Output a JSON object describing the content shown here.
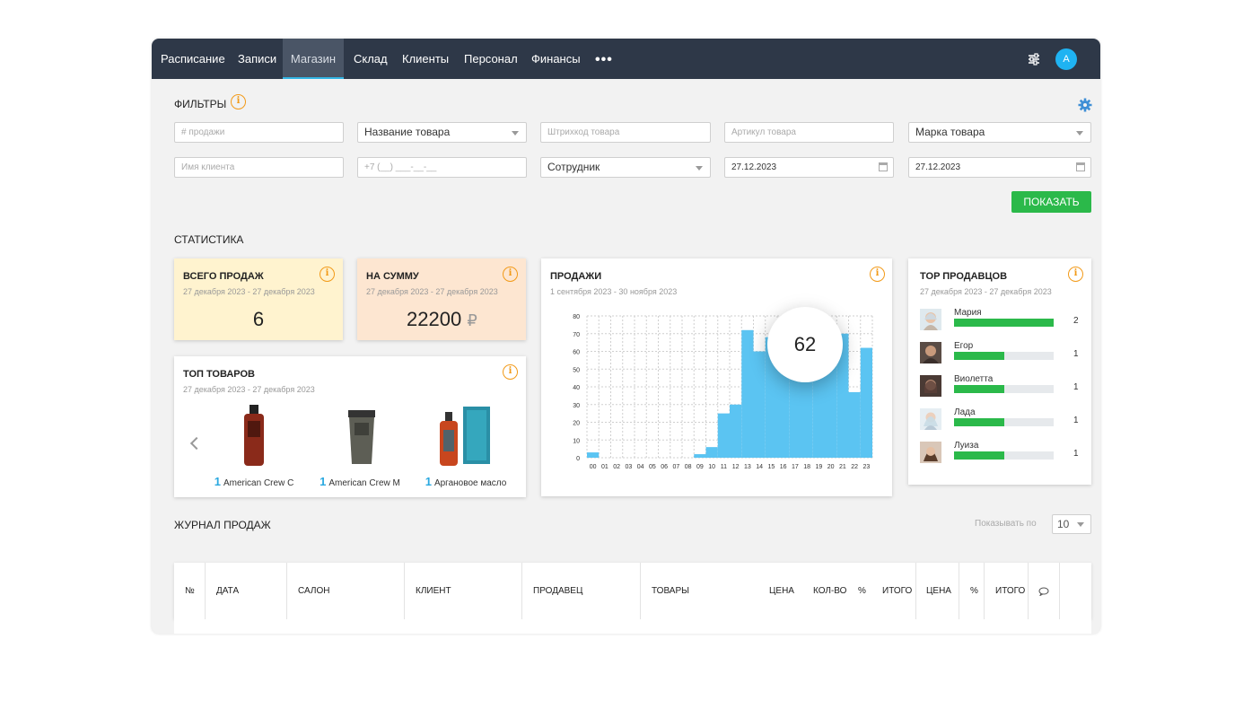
{
  "nav": {
    "items": [
      {
        "label": "Расписание"
      },
      {
        "label": "Записи"
      },
      {
        "label": "Магазин"
      },
      {
        "label": "Склад"
      },
      {
        "label": "Клиенты"
      },
      {
        "label": "Персонал"
      },
      {
        "label": "Финансы"
      }
    ],
    "active_index": 2,
    "more_label": "•••",
    "avatar_letter": "A"
  },
  "filters": {
    "title": "ФИЛЬТРЫ",
    "info_glyph": "i",
    "sale_number_placeholder": "# продажи",
    "product_name_select": "Название товара",
    "barcode_placeholder": "Штрихкод товара",
    "article_placeholder": "Артикул товара",
    "brand_select": "Марка товара",
    "client_name_placeholder": "Имя клиента",
    "phone_placeholder": "+7 (__) ___-__-__",
    "employee_select": "Сотрудник",
    "date_from": "27.12.2023",
    "date_to": "27.12.2023",
    "show_button": "ПОКАЗАТЬ"
  },
  "stats": {
    "title": "СТАТИСТИКА",
    "total_sales": {
      "title": "ВСЕГО ПРОДАЖ",
      "period": "27 декабря 2023 - 27 декабря 2023",
      "value": "6"
    },
    "sum": {
      "title": "НА СУММУ",
      "period": "27 декабря 2023 - 27 декабря 2023",
      "value": "22200",
      "currency": "₽"
    },
    "top_products": {
      "title": "ТОП ТОВАРОВ",
      "period": "27 декабря 2023 - 27 декабря 2023",
      "items": [
        {
          "qty": "1",
          "name": "American Crew C"
        },
        {
          "qty": "1",
          "name": "American Crew M"
        },
        {
          "qty": "1",
          "name": "Аргановое масло"
        }
      ]
    },
    "sales_chart": {
      "title": "ПРОДАЖИ",
      "period": "1 сентября 2023 - 30 ноября 2023",
      "tooltip_value": "62"
    },
    "top_sellers": {
      "title": "TOP ПРОДАВЦОВ",
      "period": "27 декабря 2023 - 27 декабря 2023",
      "max": 2,
      "items": [
        {
          "name": "Мария",
          "count": 2
        },
        {
          "name": "Егор",
          "count": 1
        },
        {
          "name": "Виолетта",
          "count": 1
        },
        {
          "name": "Лада",
          "count": 1
        },
        {
          "name": "Луиза",
          "count": 1
        }
      ]
    }
  },
  "chart_data": {
    "type": "bar",
    "title": "ПРОДАЖИ",
    "subtitle": "1 сентября 2023 - 30 ноября 2023",
    "categories": [
      "00",
      "01",
      "02",
      "03",
      "04",
      "05",
      "06",
      "07",
      "08",
      "09",
      "10",
      "11",
      "12",
      "13",
      "14",
      "15",
      "16",
      "17",
      "18",
      "19",
      "20",
      "21",
      "22",
      "23"
    ],
    "values": [
      3,
      0,
      0,
      0,
      0,
      0,
      0,
      0,
      0,
      2,
      6,
      25,
      30,
      72,
      60,
      68,
      62,
      62,
      62,
      62,
      62,
      70,
      37,
      62
    ],
    "ylim": [
      0,
      80
    ],
    "yticks": [
      0,
      10,
      20,
      30,
      40,
      50,
      60,
      70,
      80
    ],
    "grid": true,
    "color": "#5bc4f2"
  },
  "journal": {
    "title": "ЖУРНАЛ ПРОДАЖ",
    "per_page_label": "Показывать по",
    "per_page_value": "10",
    "columns": [
      "№",
      "ДАТА",
      "САЛОН",
      "КЛИЕНТ",
      "ПРОДАВЕЦ",
      "ТОВАРЫ",
      "ЦЕНА",
      "КОЛ-ВО",
      "%",
      "ИТОГО",
      "ЦЕНА",
      "%",
      "ИТОГО"
    ]
  }
}
